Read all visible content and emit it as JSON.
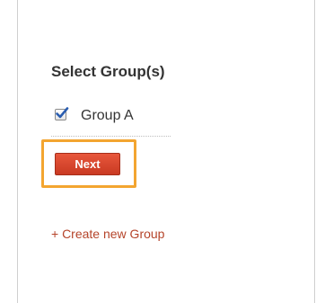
{
  "page": {
    "title": "Select Group(s)"
  },
  "groups": [
    {
      "label": "Group A",
      "checked": true
    }
  ],
  "buttons": {
    "next_label": "Next"
  },
  "links": {
    "create_group_label": "+ Create new Group"
  },
  "colors": {
    "accent_red": "#d4462c",
    "highlight_orange": "#f3a530",
    "link_red": "#b5442a",
    "checkmark_blue": "#2a5db0"
  }
}
